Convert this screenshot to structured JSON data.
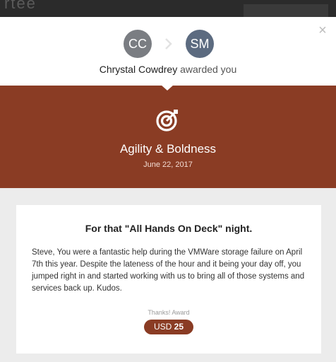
{
  "background_app": {
    "ghost_text": "rtee"
  },
  "modal": {
    "close_label": "×",
    "sender": {
      "initials": "CC",
      "color": "#7a7d82"
    },
    "recipient": {
      "initials": "SM",
      "color": "#5c6b80"
    },
    "arrow_icon": "chevron-right-icon",
    "sender_name": "Chrystal Cowdrey",
    "verb": "awarded you"
  },
  "award": {
    "icon": "target-icon",
    "title": "Agility & Boldness",
    "date": "June 22, 2017",
    "banner_color": "#8a3c24"
  },
  "message": {
    "title": "For that \"All Hands On Deck\" night.",
    "body": "Steve, You were a fantastic help during the VMWare storage failure on April 7th this year. Despite the lateness of the hour and it being your day off, you jumped right in and started working with us to bring all of those systems and services back up. Kudos.",
    "award_type": "Thanks! Award",
    "currency": "USD",
    "amount": "25"
  }
}
